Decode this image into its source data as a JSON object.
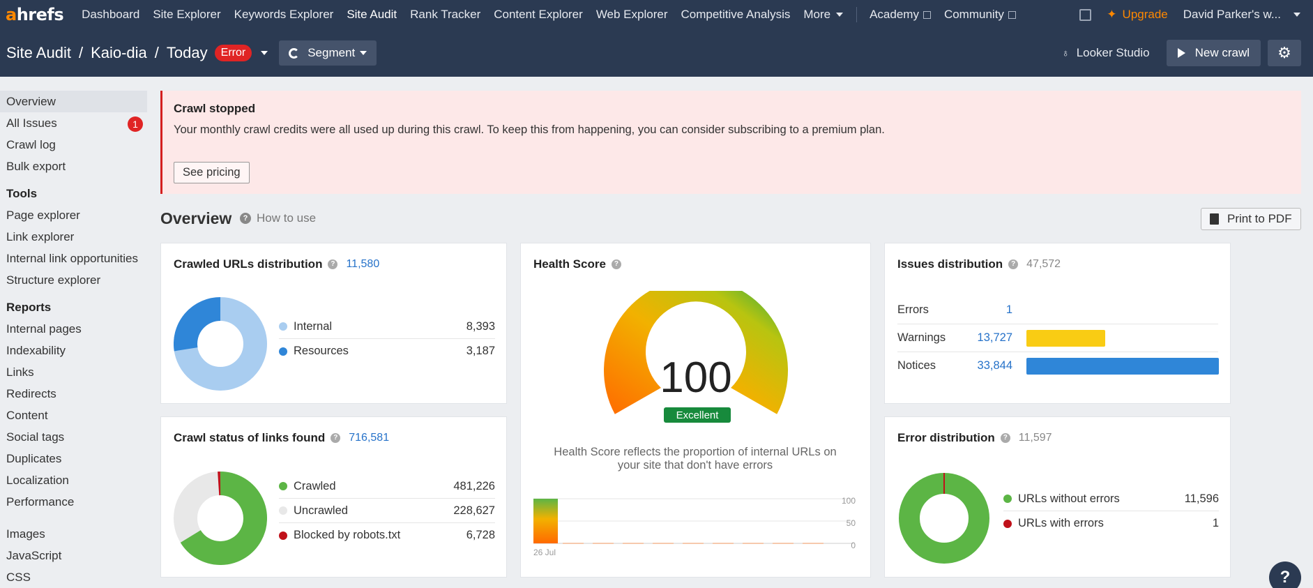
{
  "topnav": {
    "logo_a": "a",
    "logo_rest": "hrefs",
    "items": [
      "Dashboard",
      "Site Explorer",
      "Keywords Explorer",
      "Site Audit",
      "Rank Tracker",
      "Content Explorer",
      "Web Explorer",
      "Competitive Analysis",
      "More"
    ],
    "academy": "Academy",
    "community": "Community",
    "upgrade": "Upgrade",
    "user": "David Parker's w..."
  },
  "subnav": {
    "crumb1": "Site Audit",
    "crumb2": "Kaio-dia",
    "crumb3": "Today",
    "error_badge": "Error",
    "segment": "Segment",
    "looker": "Looker Studio",
    "new_crawl": "New crawl"
  },
  "sidebar": {
    "top": [
      "Overview",
      "All Issues",
      "Crawl log",
      "Bulk export"
    ],
    "all_issues_count": "1",
    "tools_heading": "Tools",
    "tools": [
      "Page explorer",
      "Link explorer",
      "Internal link opportunities",
      "Structure explorer"
    ],
    "reports_heading": "Reports",
    "reports": [
      "Internal pages",
      "Indexability",
      "Links",
      "Redirects",
      "Content",
      "Social tags",
      "Duplicates",
      "Localization",
      "Performance"
    ],
    "more": [
      "Images",
      "JavaScript",
      "CSS"
    ]
  },
  "banner": {
    "title": "Crawl stopped",
    "message": "Your monthly crawl credits were all used up during this crawl. To keep this from happening, you can consider subscribing to a premium plan.",
    "button": "See pricing"
  },
  "overview": {
    "title": "Overview",
    "how_to_use": "How to use",
    "print": "Print to PDF"
  },
  "crawled_urls": {
    "title": "Crawled URLs distribution",
    "total": "11,580",
    "rows": [
      {
        "label": "Internal",
        "value": "8,393",
        "color": "#a9cdf0"
      },
      {
        "label": "Resources",
        "value": "3,187",
        "color": "#2f86d8"
      }
    ]
  },
  "health": {
    "title": "Health Score",
    "score": "100",
    "rating": "Excellent",
    "description": "Health Score reflects the proportion of internal URLs on your site that don't have errors",
    "chart_date": "26 Jul",
    "ticks": [
      "100",
      "50",
      "0"
    ]
  },
  "issues": {
    "title": "Issues distribution",
    "total": "47,572",
    "rows": [
      {
        "label": "Errors",
        "value": "1",
        "color": "#e02424"
      },
      {
        "label": "Warnings",
        "value": "13,727",
        "color": "#f9cc14"
      },
      {
        "label": "Notices",
        "value": "33,844",
        "color": "#2f86d8"
      }
    ]
  },
  "crawl_status": {
    "title": "Crawl status of links found",
    "total": "716,581",
    "rows": [
      {
        "label": "Crawled",
        "value": "481,226",
        "color": "#5cb545"
      },
      {
        "label": "Uncrawled",
        "value": "228,627",
        "color": "#e8e8e8"
      },
      {
        "label": "Blocked by robots.txt",
        "value": "6,728",
        "color": "#c0111a"
      }
    ]
  },
  "errors": {
    "title": "Error distribution",
    "total": "11,597",
    "rows": [
      {
        "label": "URLs without errors",
        "value": "11,596",
        "color": "#5cb545"
      },
      {
        "label": "URLs with errors",
        "value": "1",
        "color": "#c0111a"
      }
    ]
  }
}
